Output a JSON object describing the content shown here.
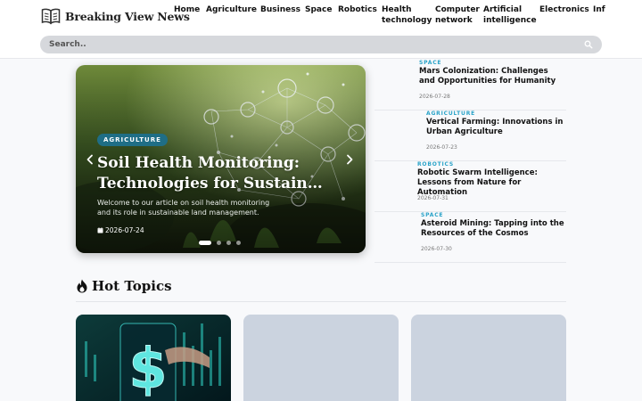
{
  "brand": {
    "name": "Breaking View News"
  },
  "nav": {
    "items": [
      {
        "label": "Home"
      },
      {
        "label": "Agriculture"
      },
      {
        "label": "Business"
      },
      {
        "label": "Space"
      },
      {
        "label": "Robotics"
      },
      {
        "label": "Health",
        "label2": "technology"
      },
      {
        "label": "Computer",
        "label2": "network"
      },
      {
        "label": "Artificial",
        "label2": "intelligence"
      },
      {
        "label": "Electronics"
      },
      {
        "label": "Inf"
      }
    ]
  },
  "search": {
    "placeholder": "Search.."
  },
  "hero": {
    "badge": "AGRICULTURE",
    "title_line1": "Soil Health Monitoring:",
    "title_line2": "Technologies for Sustainable...",
    "description": "Welcome to our article on soil health monitoring and its role in sustainable land management.",
    "date": "2026-07-24",
    "slide_index": 1,
    "slide_count": 4
  },
  "side_articles": [
    {
      "category": "SPACE",
      "title": "Mars Colonization: Challenges and Opportunities for Humanity",
      "date": "2026-07-28"
    },
    {
      "category": "AGRICULTURE",
      "title": "Vertical Farming: Innovations in Urban Agriculture",
      "date": "2026-07-23"
    },
    {
      "category": "ROBOTICS",
      "title": "Robotic Swarm Intelligence: Lessons from Nature for Automation",
      "date": "2026-07-31"
    },
    {
      "category": "SPACE",
      "title": "Asteroid Mining: Tapping into the Resources of the Cosmos",
      "date": "2026-07-30"
    }
  ],
  "hot_topics": {
    "title": "Hot Topics"
  },
  "colors": {
    "accent": "#2aa3c8",
    "badge": "#1f6e86",
    "placeholder_card": "#cbd3df"
  },
  "icons": {
    "brand": "open-book-icon",
    "search": "search-icon",
    "hot": "fire-icon",
    "date": "calendar-icon"
  }
}
